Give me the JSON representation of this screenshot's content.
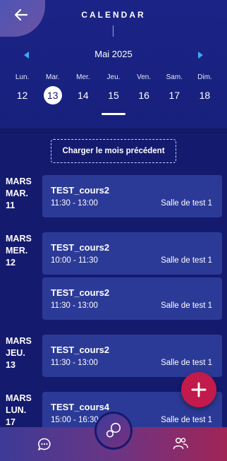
{
  "header": {
    "title": "CALENDAR",
    "month_label": "Mai 2025"
  },
  "week": [
    {
      "name": "Lun.",
      "num": "12"
    },
    {
      "name": "Mar.",
      "num": "13",
      "selected": true
    },
    {
      "name": "Mer.",
      "num": "14"
    },
    {
      "name": "Jeu.",
      "num": "15"
    },
    {
      "name": "Ven.",
      "num": "16"
    },
    {
      "name": "Sam.",
      "num": "17"
    },
    {
      "name": "Dim.",
      "num": "18"
    }
  ],
  "load_previous_label": "Charger le mois précédent",
  "days": [
    {
      "month": "MARS",
      "weekday": "MAR.",
      "date": "11",
      "events": [
        {
          "title": "TEST_cours2",
          "time": "11:30 - 13:00",
          "room": "Salle de test 1"
        }
      ]
    },
    {
      "month": "MARS",
      "weekday": "MER.",
      "date": "12",
      "events": [
        {
          "title": "TEST_cours2",
          "time": "10:00 - 11:30",
          "room": "Salle de test 1"
        },
        {
          "title": "TEST_cours2",
          "time": "11:30 - 13:00",
          "room": "Salle de test 1"
        }
      ]
    },
    {
      "month": "MARS",
      "weekday": "JEU.",
      "date": "13",
      "events": [
        {
          "title": "TEST_cours2",
          "time": "11:30 - 13:00",
          "room": "Salle de test 1"
        }
      ]
    },
    {
      "month": "MARS",
      "weekday": "LUN.",
      "date": "17",
      "events": [
        {
          "title": "TEST_cours4",
          "time": "15:00 - 16:30",
          "room": "Salle de test 1"
        }
      ]
    }
  ],
  "icons": {
    "back": "arrow-left-icon",
    "prev_month": "triangle-left-icon",
    "next_month": "triangle-right-icon",
    "add": "plus-icon",
    "chat": "chat-bubble-icon",
    "center": "bubbles-icon",
    "users": "users-icon"
  },
  "colors": {
    "background": "#141a6e",
    "card": "#2c3a97",
    "accent_arrow": "#3fa9f5",
    "fab": "#c21a4a"
  }
}
